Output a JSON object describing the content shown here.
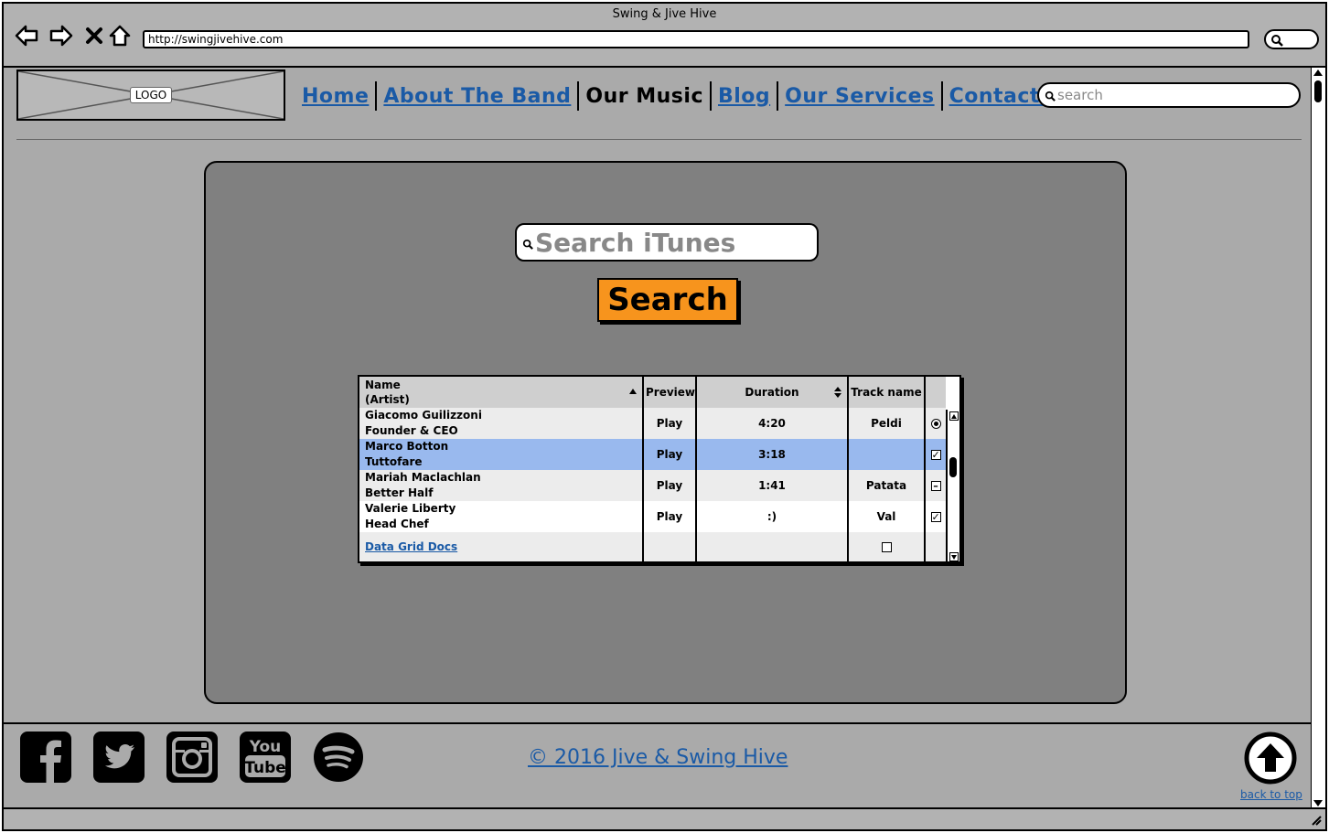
{
  "window": {
    "title": "Swing & Jive Hive"
  },
  "browser": {
    "url": "http://swingjivehive.com"
  },
  "header": {
    "logo_label": "LOGO",
    "nav": [
      {
        "label": "Home",
        "active": false
      },
      {
        "label": "About The Band",
        "active": false
      },
      {
        "label": "Our Music",
        "active": true
      },
      {
        "label": "Blog",
        "active": false
      },
      {
        "label": "Our Services",
        "active": false
      },
      {
        "label": "Contact Us",
        "active": false
      }
    ],
    "search_placeholder": "search"
  },
  "main": {
    "itunes_search_placeholder": "Search iTunes",
    "search_button_label": "Search",
    "grid": {
      "columns": [
        {
          "label": "Name\n(Artist)",
          "sort": "asc"
        },
        {
          "label": "Preview"
        },
        {
          "label": "Duration",
          "sort": "both"
        },
        {
          "label": "Track name"
        },
        {
          "label": ""
        }
      ],
      "rows": [
        {
          "name": "Giacomo Guilizzoni",
          "artist": "Founder & CEO",
          "preview": "Play",
          "duration": "4:20",
          "track": "Peldi",
          "control": "radio",
          "selected": false
        },
        {
          "name": "Marco Botton",
          "artist": "Tuttofare",
          "preview": "Play",
          "duration": "3:18",
          "track": "",
          "control": "checked",
          "selected": true
        },
        {
          "name": "Mariah Maclachlan",
          "artist": "Better Half",
          "preview": "Play",
          "duration": "1:41",
          "track": "Patata",
          "control": "indeterminate",
          "selected": false
        },
        {
          "name": "Valerie Liberty",
          "artist": "Head Chef",
          "preview": "Play",
          "duration": ":)",
          "track": "Val",
          "control": "checked",
          "selected": false
        }
      ],
      "footer_link": "Data Grid Docs",
      "footer_control": "unchecked"
    }
  },
  "footer": {
    "social_icons": [
      "facebook-icon",
      "twitter-icon",
      "instagram-icon",
      "youtube-icon",
      "spotify-icon"
    ],
    "youtube_text_top": "You",
    "youtube_text_bottom": "Tube",
    "copyright": "© 2016 Jive & Swing Hive",
    "back_to_top": "back to top"
  },
  "colors": {
    "link": "#1a5aa6",
    "search_button": "#f7941d",
    "selected_row": "#99b9ee",
    "panel": "#808080",
    "page": "#aaaaaa"
  }
}
